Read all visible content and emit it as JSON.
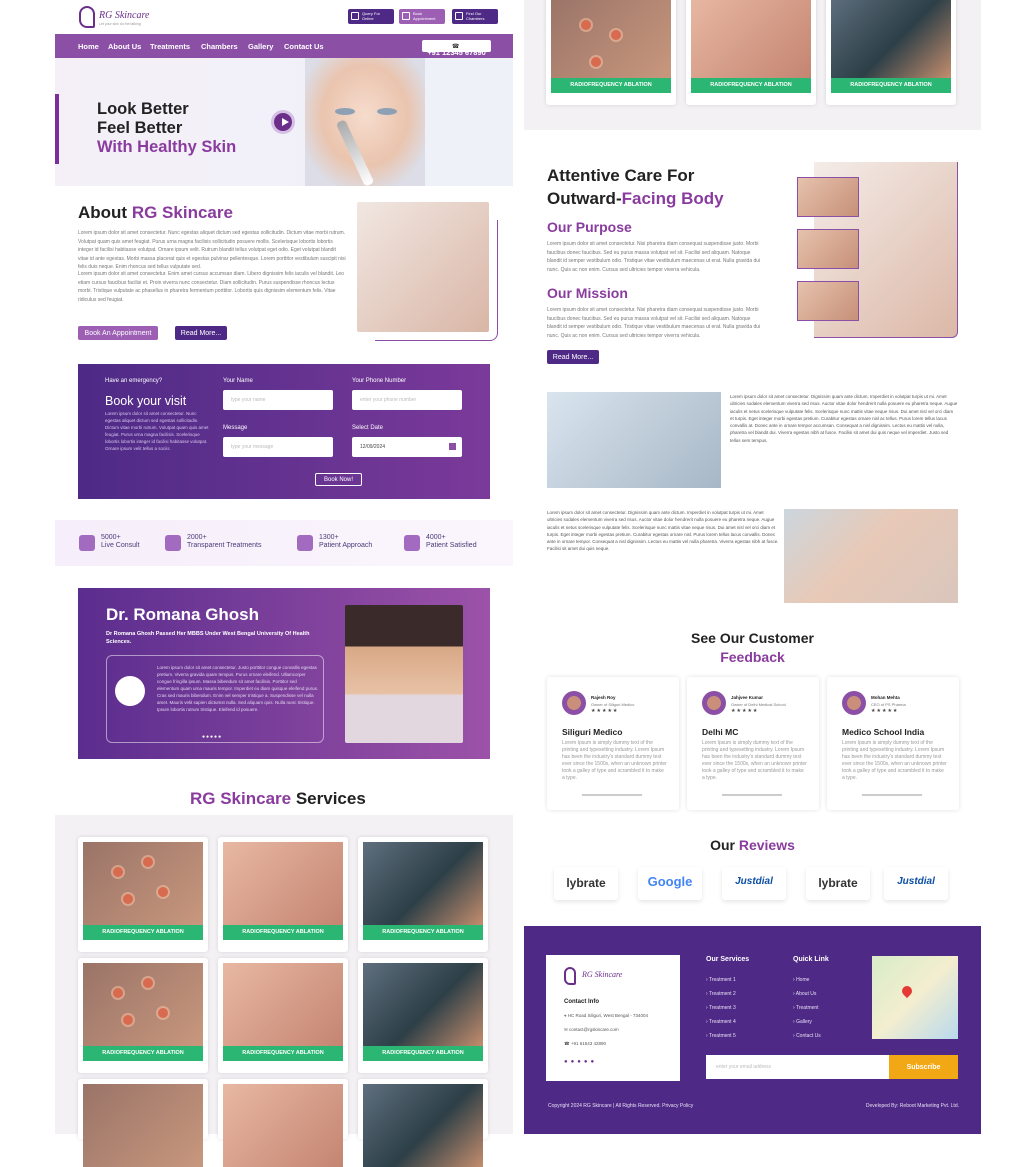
{
  "brand": {
    "name": "RG Skincare",
    "tagline": "Let your skin do the talking"
  },
  "topbar": {
    "buttons": [
      "Query For Online",
      "Book Appointment",
      "Find Our Chambers"
    ]
  },
  "nav": {
    "items": [
      "Home",
      "About Us",
      "Treatments",
      "Chambers",
      "Gallery",
      "Contact Us"
    ],
    "phone": "+91 12345 67890"
  },
  "hero": {
    "line1": "Look Better",
    "line2": "Feel Better",
    "line3": "With Healthy Skin"
  },
  "about": {
    "title_a": "About",
    "title_b": "RG Skincare",
    "text": "Lorem ipsum dolor sit amet consectetur. Nunc egestas aliquet dictum sed egestas sollicitudin. Dictum vitae morbi rutrum. Volutpat quam quis amet feugiat. Purus urna magna facilisis sollicitudin posuere mollis. Scelerisque lobortis lobortis integer id facilisi habitasse volutpat. Ornare ipsum velit. Rutrum blandit tellus volutpat eget odio. Eget volutpat blandit vitae id ante egestas. Morbi massa placerat quis et egestas pulvinar pellentesque. Lorem porttitor vestibulum suscipit nisi felis duis neque. Enim rhoncus sed tellus vulputate sed.",
    "text2": "Lorem ipsum dolor sit amet consectetur. Enim amet cursus accumsan diam. Libero dignissim felis iaculis vel blandit. Leo etiam cursus faucibus facilisi et. Proin viverra nunc consectetur. Diam sollicitudin. Purus suspendisse rhoncus lectus morbi. Tristique vulputate ac phasellus in pharetra fermentum porttitor. Lobortis quis dignissim elementum felis. Vitae ridiculus sed feugiat.",
    "btn_book": "Book An Appointment",
    "btn_more": "Read More..."
  },
  "form": {
    "emergency": "Have an emergency?",
    "title": "Book your visit",
    "desc": "Lorem ipsum dolor sit amet consectetur. Nunc egestas aliquet dictum sed egestas sollicitudin. Dictum vitae morbi rutrum. Volutpat quam quis amet feugiat. Purus urna magna facilisis. Scelerisque lobortis lobortis integer id facilisi habitasse volutpat. Ornare ipsum velit tellus a sociis.",
    "name_label": "Your Name",
    "name_ph": "type your name",
    "phone_label": "Your Phone Number",
    "phone_ph": "enter your phone number",
    "msg_label": "Message",
    "msg_ph": "type your message",
    "date_label": "Select Date",
    "date_value": "12/09/2024",
    "submit": "Book Now!"
  },
  "stats": [
    {
      "num": "5000+",
      "label": "Live Consult"
    },
    {
      "num": "2000+",
      "label": "Transparent Treatments"
    },
    {
      "num": "1300+",
      "label": "Patient Approach"
    },
    {
      "num": "4000+",
      "label": "Patient Satisfied"
    }
  ],
  "doctor": {
    "name": "Dr. Romana Ghosh",
    "sub": "Dr Romana Ghosh Passed Her MBBS Under West Bengal University Of Health Sciences.",
    "text": "Lorem ipsum dolor sit amet consectetur. Justo porttitor congue convallis egestas pretium. Viverra gravida quam tempus. Purus ornare eleifend. Ullamcorper congue fringilla ipsum. Massa bibendum sit amet facilisis. Porttitor sed elementum quam urna mauris tempor. Imperdiet eu diam quisque eleifend purus. Cras sed mauris bibendum. Enim vel semper tristique a. Suspendisse vel nulla amet. Mauris velit sapien dictumst nulla. Sed aliquam quis. Nulla nunc tristique. Ipsum lobortis rutrum tristique. Eleifend id posuere."
  },
  "services": {
    "title_a": "RG Skincare",
    "title_b": "Services",
    "cards": [
      "RADIOFREQUENCY ABLATION",
      "RADIOFREQUENCY ABLATION",
      "RADIOFREQUENCY ABLATION",
      "RADIOFREQUENCY ABLATION",
      "RADIOFREQUENCY ABLATION",
      "RADIOFREQUENCY ABLATION"
    ],
    "top_cards": [
      "RADIOFREQUENCY ABLATION",
      "RADIOFREQUENCY ABLATION",
      "RADIOFREQUENCY ABLATION"
    ]
  },
  "care": {
    "title1": "Attentive Care For",
    "title2a": "Outward-",
    "title2b": "Facing Body",
    "purpose_h": "Our Purpose",
    "purpose_t": "Lorem ipsum dolor sit amet consectetur. Nisi pharetra diam consequat suspendisse justo. Morbi faucibus donec faucibus. Sed eu purus massa volutpat vel sit. Facilisi sed aliquam. Natoque blandit id semper vestibulum odio. Tristique vitae vestibulum maecenas ut erat. Nulla gravida dui nunc. Quis ac non enim. Cursus sed ultricies tempor viverra vehicula.",
    "mission_h": "Our Mission",
    "mission_t": "Lorem ipsum dolor sit amet consectetur. Nisi pharetra diam consequat suspendisse justo. Morbi faucibus donec faucibus. Sed eu purus massa volutpat vel sit. Facilisi sed aliquam. Natoque blandit id semper vestibulum odio. Tristique vitae vestibulum maecenas ut erat. Nulla gravida dui nunc. Quis ac non enim. Cursus sed ultricies tempor viverra vehicula.",
    "btn": "Read More..."
  },
  "info": {
    "text1": "Lorem ipsum dolor sit amet consectetur. Dignissim quam ante dictum. Imperdiet in volutpat turpis ut mi. Amet ultricies sodales elementum viverra sed risus. Auctor vitae dolor hendrerit nulla posuere eu pharetra neque. Augue iaculis et netus scelerisque vulputate felis. Scelerisque nunc mattis vitae neque risus. Dui amet nisl vel orci diam et turpis. Eget integer morbi egestas pretium. Curabitur egestas ornare nisl ac tellus. Purus lorem tellus lacus convallis at. Donec ante in ornare tempor accumsan. Consequat a nisl dignissim. Lectus eu mattis vel nulla, pharetra vel blandit dui. Viverra egestas nibh at fusce. Facilisi sit amet dui quis neque vel imperdiet. Justo sed tellus sem tempus.",
    "text2": "Lorem ipsum dolor sit amet consectetur. Dignissim quam ante dictum. Imperdiet in volutpat turpis ut mi. Amet ultricies sodales elementum viverra sed risus. Auctor vitae dolor hendrerit nulla posuere eu pharetra neque. Augue iaculis et netus scelerisque vulputate felis. Scelerisque nunc mattis vitae neque risus. Dui amet nisl vel orci diam et turpis. Eget integer morbi egestas pretium. Curabitur egestas ornare nisl. Purus lorem tellus lacus convallis. Donec ante in ornare tempor. Consequat a nisl dignissim. Lectus eu mattis vel nulla pharetra. Viverra egestas nibh at fusce. Facilisi sit amet dui quis neque."
  },
  "feedback": {
    "title1": "See Our Customer",
    "title2": "Feedback",
    "items": [
      {
        "name": "Rajesh Roy",
        "role": "Owner of Siliguri Medico",
        "stars": "★★★★★",
        "title": "Siliguri Medico"
      },
      {
        "name": "Jahjvee Kumar",
        "role": "Owner of Delhi Medical School",
        "stars": "★★★★★",
        "title": "Delhi MC"
      },
      {
        "name": "Mohan Mehta",
        "role": "CEO of PS Pharma",
        "stars": "★★★★★",
        "title": "Medico School India"
      }
    ],
    "text": "Lorem Ipsum is simply dummy text of the printing and typesetting industry. Lorem Ipsum has been the industry's standard dummy text ever since the 1500s, when an unknown printer took a galley of type and scrambled it to make a type."
  },
  "reviews": {
    "title_a": "Our",
    "title_b": "Reviews",
    "logos": [
      "lybrate",
      "Google",
      "Justdial",
      "lybrate",
      "Justdial"
    ]
  },
  "footer": {
    "contact_h": "Contact Info",
    "address": "HC Road Siliguri, West Bengal - 734004",
    "email": "contact@rgskincare.com",
    "phone": "+91 61543 42890",
    "services_h": "Our Services",
    "services": [
      "Treatment 1",
      "Treatment 2",
      "Treatment 3",
      "Treatment 4",
      "Treatment 5"
    ],
    "quick_h": "Quick Link",
    "quick": [
      "Home",
      "About Us",
      "Treatment",
      "Gallery",
      "Contact Us"
    ],
    "email_ph": "enter your email address",
    "subscribe": "Subscribe",
    "copyright": "Copyright 2024 RG Skincare | All Rights Reserved. Privacy Policy",
    "dev": "Developed By: Reboot Marketing Pvt. Ltd.",
    "colors": {
      "footer_bg": "#4e2a86",
      "accent": "#8b4fa6",
      "green": "#2bb673",
      "orange": "#f2a714"
    }
  }
}
